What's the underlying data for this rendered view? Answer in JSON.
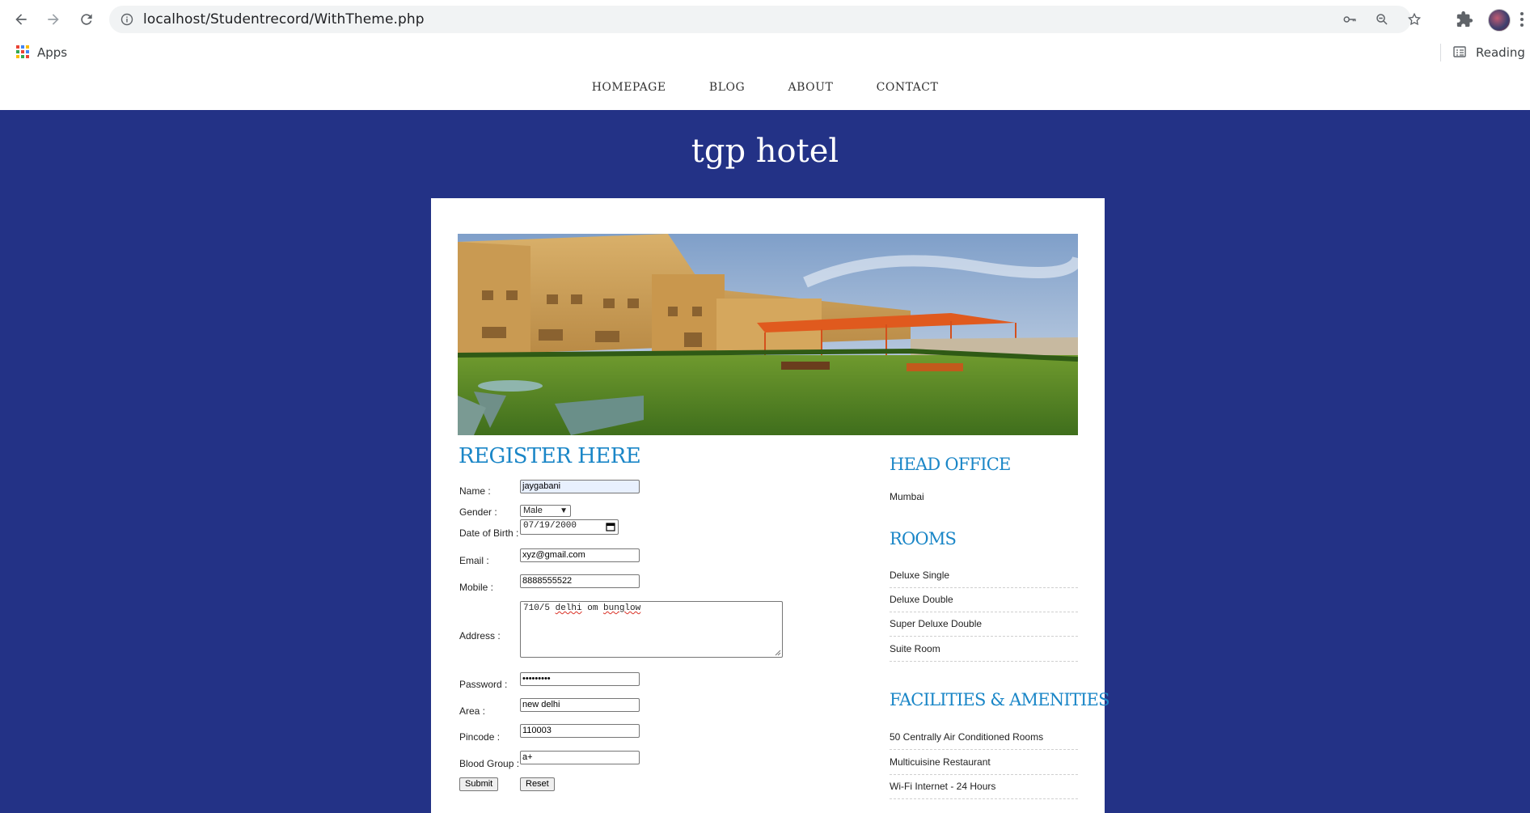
{
  "browser": {
    "url": "localhost/Studentrecord/WithTheme.php",
    "bookmarks": {
      "apps_label": "Apps",
      "reading_list_label": "Reading list"
    }
  },
  "site": {
    "nav": [
      "HOMEPAGE",
      "BLOG",
      "ABOUT",
      "CONTACT"
    ],
    "title": "tgp hotel"
  },
  "form": {
    "title": "REGISTER HERE",
    "labels": {
      "name": "Name :",
      "gender": "Gender :",
      "dob": "Date of Birth :",
      "email": "Email :",
      "mobile": "Mobile :",
      "address": "Address :",
      "password": "Password :",
      "area": "Area :",
      "pincode": "Pincode :",
      "blood": "Blood Group :"
    },
    "values": {
      "name": "jaygabani",
      "gender": "Male",
      "dob": "07/19/2000",
      "email": "xyz@gmail.com",
      "mobile": "8888555522",
      "address_a": "710/5 ",
      "address_b": "delhi",
      "address_c": " om ",
      "address_d": "bunglow",
      "password": "•••••••••",
      "area": "new delhi",
      "pincode": "110003",
      "blood": "a+"
    },
    "buttons": {
      "submit": "Submit",
      "reset": "Reset"
    }
  },
  "sidebar": {
    "head_office": {
      "title": "HEAD OFFICE",
      "city": "Mumbai"
    },
    "rooms": {
      "title": "ROOMS",
      "items": [
        "Deluxe Single",
        "Deluxe Double",
        "Super Deluxe Double",
        "Suite Room"
      ]
    },
    "facilities": {
      "title": "FACILITIES & AMENITIES",
      "items": [
        "50 Centrally Air Conditioned Rooms",
        "Multicuisine Restaurant",
        "Wi-Fi Internet - 24 Hours"
      ]
    }
  },
  "colors": {
    "page_bg": "#233286",
    "heading_blue": "#1a86c7",
    "card_bg": "#ffffff"
  },
  "icons": [
    "back-arrow-icon",
    "forward-arrow-icon",
    "reload-icon",
    "info-icon",
    "key-icon",
    "zoom-out-icon",
    "star-icon",
    "puzzle-icon",
    "kebab-icon",
    "apps-grid-icon",
    "reading-list-icon",
    "calendar-icon"
  ]
}
